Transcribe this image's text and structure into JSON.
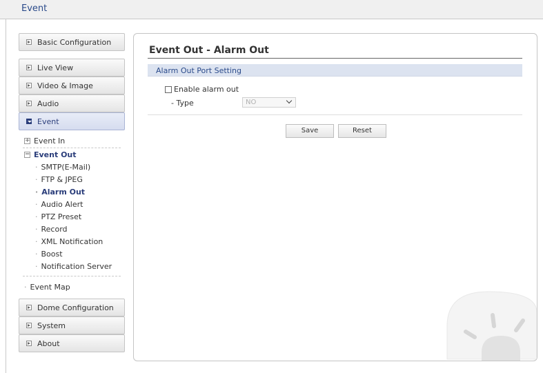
{
  "header": {
    "title": "Event"
  },
  "sidebar": {
    "basic_configuration": "Basic Configuration",
    "live_view": "Live View",
    "video_image": "Video & Image",
    "audio": "Audio",
    "event": "Event",
    "event_in": "Event In",
    "event_out": "Event Out",
    "event_out_items": [
      "SMTP(E-Mail)",
      "FTP & JPEG",
      "Alarm Out",
      "Audio Alert",
      "PTZ Preset",
      "Record",
      "XML Notification",
      "Boost",
      "Notification Server"
    ],
    "event_map": "Event Map",
    "dome_configuration": "Dome Configuration",
    "system": "System",
    "about": "About"
  },
  "main": {
    "title": "Event Out - Alarm Out",
    "section": "Alarm Out Port Setting",
    "enable_label": "Enable alarm out",
    "enable_checked": false,
    "type_label": "- Type",
    "type_value": "NO",
    "save_label": "Save",
    "reset_label": "Reset"
  },
  "colors": {
    "accent": "#2a3d7a",
    "section_bg": "#dce3f0"
  }
}
